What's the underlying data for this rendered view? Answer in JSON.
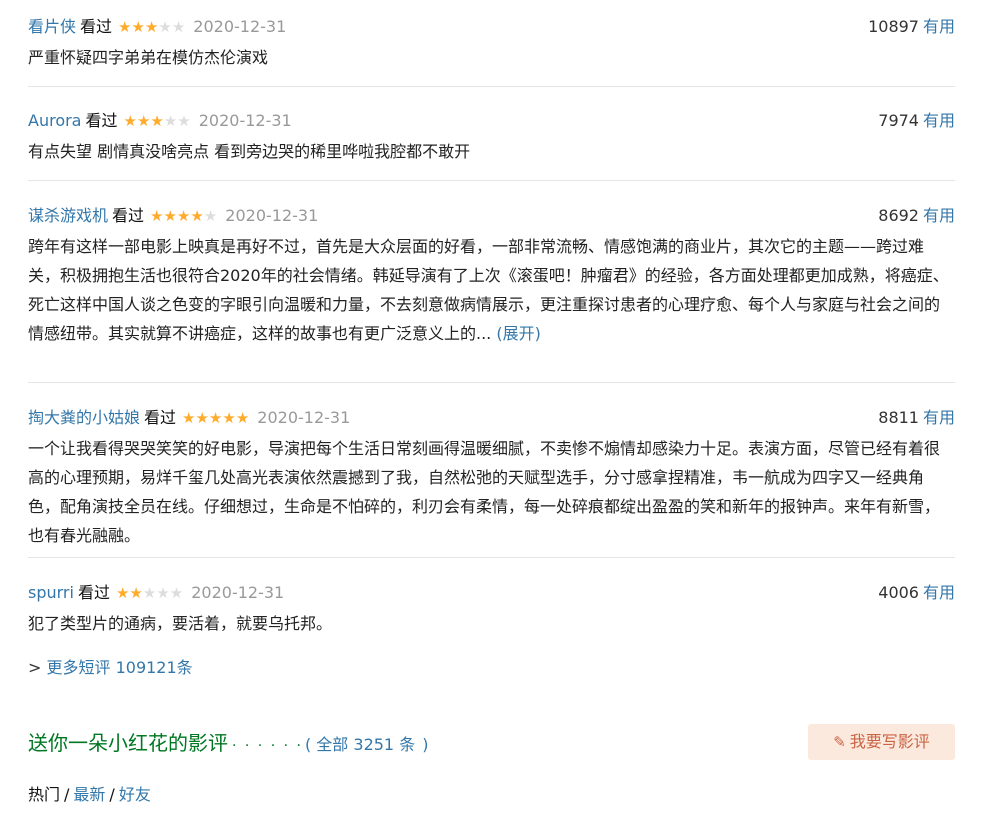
{
  "reviews": [
    {
      "author": "看片侠",
      "status": "看过",
      "stars_on": "★★★",
      "stars_off": "★★",
      "rating": 3,
      "date": "2020-12-31",
      "votes": "10897",
      "useful": "有用",
      "text": "严重怀疑四字弟弟在模仿杰伦演戏"
    },
    {
      "author": "Aurora",
      "status": "看过",
      "stars_on": "★★★",
      "stars_off": "★★",
      "rating": 3,
      "date": "2020-12-31",
      "votes": "7974",
      "useful": "有用",
      "text": "有点失望 剧情真没啥亮点 看到旁边哭的稀里哗啦我腔都不敢开"
    },
    {
      "author": "谋杀游戏机",
      "status": "看过",
      "stars_on": "★★★★",
      "stars_off": "★",
      "rating": 4,
      "date": "2020-12-31",
      "votes": "8692",
      "useful": "有用",
      "text": "跨年有这样一部电影上映真是再好不过，首先是大众层面的好看，一部非常流畅、情感饱满的商业片，其次它的主题——跨过难关，积极拥抱生活也很符合2020年的社会情绪。韩延导演有了上次《滚蛋吧！肿瘤君》的经验，各方面处理都更加成熟，将癌症、死亡这样中国人谈之色变的字眼引向温暖和力量，不去刻意做病情展示，更注重探讨患者的心理疗愈、每个人与家庭与社会之间的情感纽带。其实就算不讲癌症，这样的故事也有更广泛意义上的...",
      "expand": "(展开)"
    },
    {
      "author": "掏大粪的小姑娘",
      "status": "看过",
      "stars_on": "★★★★★",
      "stars_off": "",
      "rating": 5,
      "date": "2020-12-31",
      "votes": "8811",
      "useful": "有用",
      "text": "一个让我看得哭哭笑笑的好电影，导演把每个生活日常刻画得温暖细腻，不卖惨不煽情却感染力十足。表演方面，尽管已经有着很高的心理预期，易烊千玺几处高光表演依然震撼到了我，自然松弛的天赋型选手，分寸感拿捏精准，韦一航成为四字又一经典角色，配角演技全员在线。仔细想过，生命是不怕碎的，利刃会有柔情，每一处碎痕都绽出盈盈的笑和新年的报钟声。来年有新雪，也有春光融融。"
    },
    {
      "author": "spurri",
      "status": "看过",
      "stars_on": "★★",
      "stars_off": "★★★",
      "rating": 2,
      "date": "2020-12-31",
      "votes": "4006",
      "useful": "有用",
      "text": "犯了类型片的通病，要活着，就要乌托邦。"
    }
  ],
  "more_short": {
    "arrow": ">",
    "label": "更多短评 109121条"
  },
  "reviews_section": {
    "title": "送你一朵小红花的影评",
    "dots": "· · · · · ·",
    "paren_open": "(",
    "all_label": "全部 3251 条",
    "paren_close": ")",
    "write_button": "我要写影评",
    "write_icon": "✎"
  },
  "sort": {
    "hot": "热门",
    "sep": "/",
    "latest": "最新",
    "friends": "好友"
  },
  "colors": {
    "link": "#3377aa",
    "star": "#ffac2d",
    "section_green": "#007722",
    "button_bg": "#fce9dd",
    "button_text": "#ca6445"
  }
}
